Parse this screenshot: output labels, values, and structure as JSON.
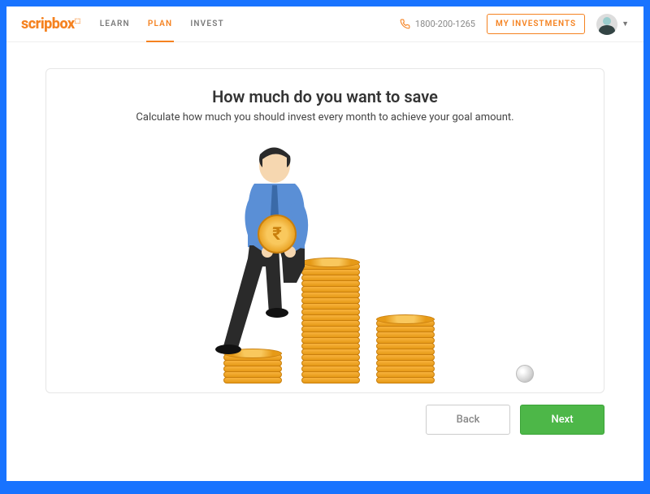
{
  "header": {
    "logo_text": "scripbox",
    "nav": [
      {
        "label": "LEARN",
        "active": false
      },
      {
        "label": "PLAN",
        "active": true
      },
      {
        "label": "INVEST",
        "active": false
      }
    ],
    "phone": "1800-200-1265",
    "my_investments_label": "MY INVESTMENTS"
  },
  "card": {
    "title": "How much do you want to save",
    "subtitle": "Calculate how much you should invest every month to achieve your goal amount.",
    "coin_symbol": "₹"
  },
  "buttons": {
    "back_label": "Back",
    "next_label": "Next"
  }
}
